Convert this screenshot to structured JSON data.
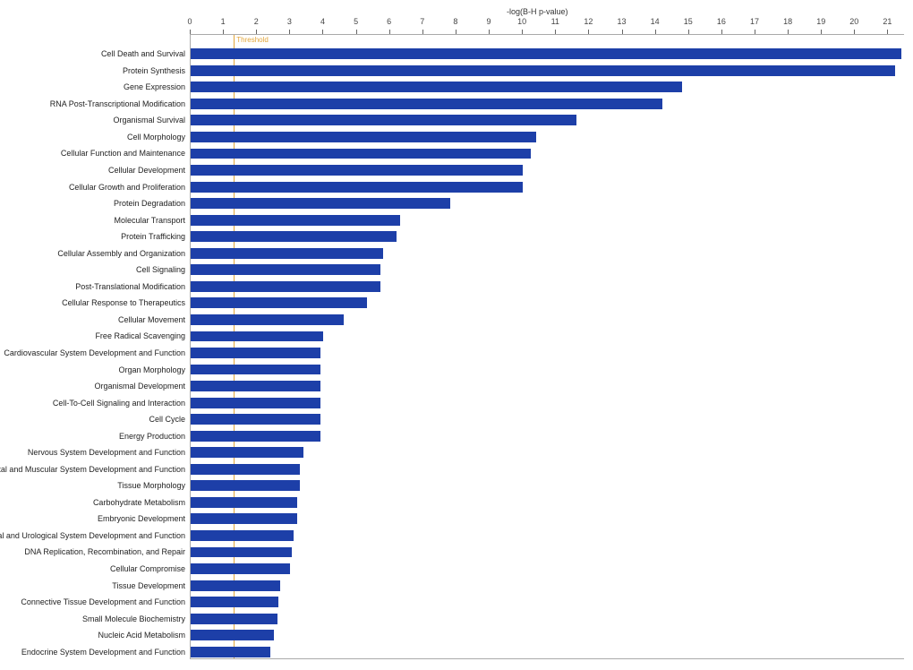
{
  "chart_data": {
    "type": "bar",
    "orientation": "horizontal",
    "title": "",
    "xlabel": "-log(B-H p-value)",
    "ylabel": "",
    "xlim": [
      0,
      21.5
    ],
    "xticks": [
      0,
      1,
      2,
      3,
      4,
      5,
      6,
      7,
      8,
      9,
      10,
      11,
      12,
      13,
      14,
      15,
      16,
      17,
      18,
      19,
      20,
      21
    ],
    "threshold": {
      "value": 1.3,
      "label": "Threshold"
    },
    "categories": [
      "Cell Death and Survival",
      "Protein Synthesis",
      "Gene Expression",
      "RNA Post-Transcriptional Modification",
      "Organismal Survival",
      "Cell Morphology",
      "Cellular Function and Maintenance",
      "Cellular Development",
      "Cellular Growth and Proliferation",
      "Protein Degradation",
      "Molecular Transport",
      "Protein Trafficking",
      "Cellular Assembly and Organization",
      "Cell Signaling",
      "Post-Translational Modification",
      "Cellular Response to Therapeutics",
      "Cellular Movement",
      "Free Radical Scavenging",
      "Cardiovascular System Development and Function",
      "Organ Morphology",
      "Organismal Development",
      "Cell-To-Cell Signaling and Interaction",
      "Cell Cycle",
      "Energy Production",
      "Nervous System Development and Function",
      "Skeletal and Muscular System Development and Function",
      "Tissue Morphology",
      "Carbohydrate Metabolism",
      "Embryonic Development",
      "Renal and Urological System Development and Function",
      "DNA Replication, Recombination, and Repair",
      "Cellular Compromise",
      "Tissue Development",
      "Connective Tissue Development and Function",
      "Small Molecule Biochemistry",
      "Nucleic Acid Metabolism",
      "Endocrine System Development and Function"
    ],
    "values": [
      21.4,
      21.2,
      14.8,
      14.2,
      11.6,
      10.4,
      10.25,
      10.0,
      10.0,
      7.8,
      6.3,
      6.2,
      5.8,
      5.7,
      5.7,
      5.3,
      4.6,
      4.0,
      3.9,
      3.9,
      3.9,
      3.9,
      3.9,
      3.9,
      3.4,
      3.3,
      3.3,
      3.2,
      3.2,
      3.1,
      3.05,
      3.0,
      2.7,
      2.65,
      2.6,
      2.5,
      2.4
    ]
  },
  "colors": {
    "bar": "#1d3fa8",
    "threshold": "#e3a63a"
  }
}
